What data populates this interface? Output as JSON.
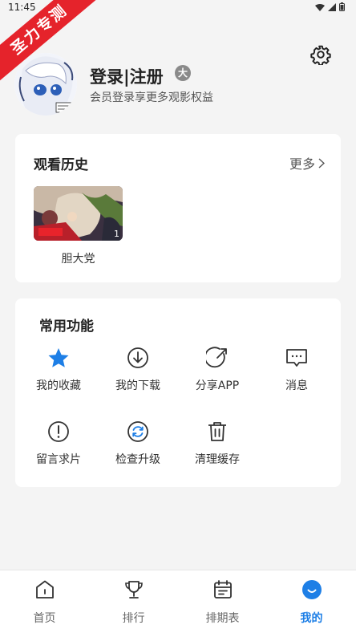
{
  "status_bar": {
    "time": "11:45"
  },
  "ribbon": {
    "text": "圣力专测"
  },
  "profile": {
    "username": "登录|注册",
    "vip_badge": "大",
    "subtitle": "会员登录享更多观影权益"
  },
  "history": {
    "title": "观看历史",
    "more_label": "更多",
    "items": [
      {
        "title": "胆大党",
        "episode": "1"
      }
    ]
  },
  "features": {
    "title": "常用功能",
    "items": [
      {
        "label": "我的收藏",
        "icon": "star-icon"
      },
      {
        "label": "我的下载",
        "icon": "download-icon"
      },
      {
        "label": "分享APP",
        "icon": "share-icon"
      },
      {
        "label": "消息",
        "icon": "message-icon"
      },
      {
        "label": "留言求片",
        "icon": "exclamation-icon"
      },
      {
        "label": "检查升级",
        "icon": "refresh-icon"
      },
      {
        "label": "清理缓存",
        "icon": "trash-icon"
      }
    ]
  },
  "tabbar": {
    "items": [
      {
        "label": "首页",
        "icon": "home-icon"
      },
      {
        "label": "排行",
        "icon": "trophy-icon"
      },
      {
        "label": "排期表",
        "icon": "calendar-icon"
      },
      {
        "label": "我的",
        "icon": "profile-icon",
        "active": true
      }
    ]
  },
  "colors": {
    "accent": "#1e7fe6",
    "ribbon": "#e5232b",
    "background": "#f4f4f4"
  }
}
